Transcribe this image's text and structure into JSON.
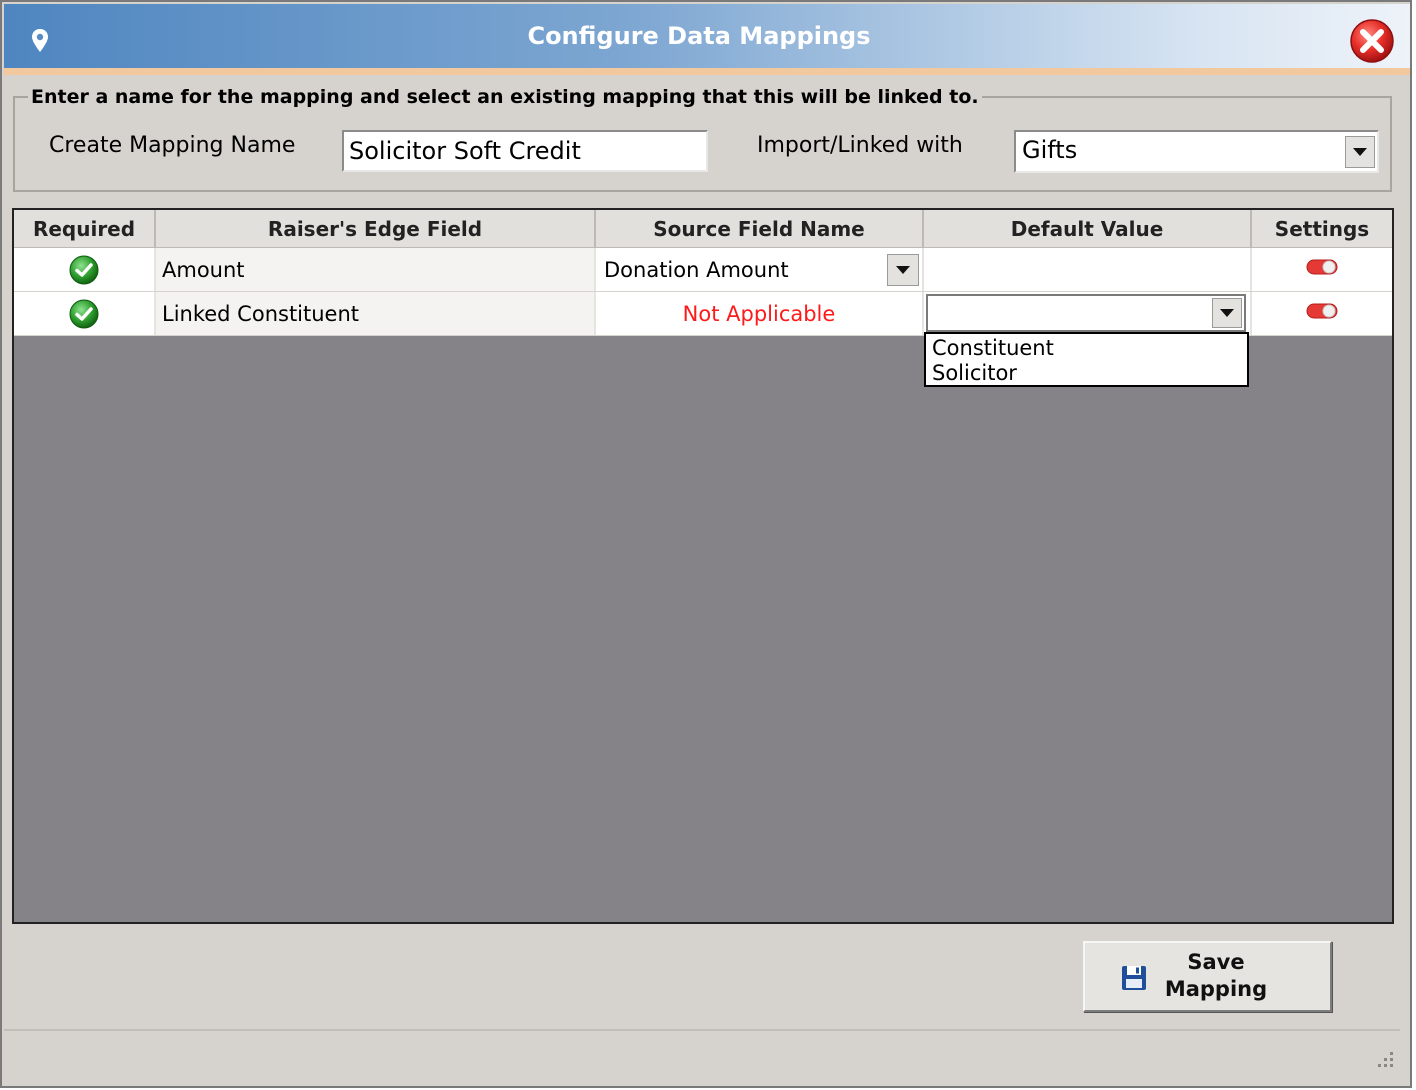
{
  "window": {
    "title": "Configure  Data Mappings"
  },
  "form": {
    "instruction": "Enter a name for the mapping and select an existing mapping that this will be linked to.",
    "mapping_name_label": "Create Mapping Name",
    "mapping_name_value": "Solicitor Soft Credit",
    "linked_with_label": "Import/Linked with",
    "linked_with_value": "Gifts"
  },
  "grid": {
    "columns": [
      "Required",
      "Raiser's Edge Field",
      "Source Field Name",
      "Default Value",
      "Settings"
    ],
    "rows": [
      {
        "required": true,
        "field": "Amount",
        "source": "Donation Amount",
        "default": ""
      },
      {
        "required": true,
        "field": "Linked Constituent",
        "source": "Not Applicable",
        "default": ""
      }
    ]
  },
  "dropdown": {
    "options": [
      "Constituent",
      "Solicitor"
    ]
  },
  "buttons": {
    "save_line1": "Save",
    "save_line2": "Mapping"
  },
  "colors": {
    "not_applicable": "#ff1a1a",
    "check_green": "#2e9e2e",
    "toggle_red": "#e53935",
    "grid_background": "#858387"
  },
  "icons": [
    "map-pin-icon",
    "close-icon",
    "check-icon",
    "toggle-icon",
    "chevron-down-icon",
    "floppy-disk-icon",
    "resize-grip-icon"
  ]
}
